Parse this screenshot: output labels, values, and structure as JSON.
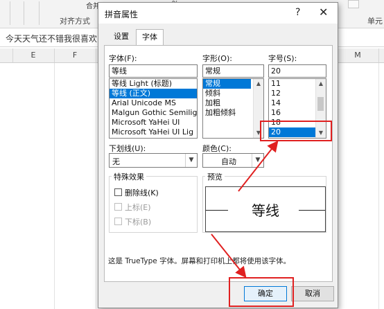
{
  "excel": {
    "ribbon_merge": "合并后居中",
    "ribbon_percent": "%",
    "ribbon_group_align": "对齐方式",
    "ribbon_right": "单元",
    "formula_text": "今天天气还不错我很喜欢",
    "columns": [
      "E",
      "F",
      "M"
    ]
  },
  "dialog": {
    "title": "拼音属性",
    "help": "?",
    "close": "✕",
    "tabs": [
      {
        "label": "设置",
        "active": false
      },
      {
        "label": "字体",
        "active": true
      }
    ],
    "font_label": "字体(F):",
    "font_value": "等线",
    "font_list": [
      "等线 Light (标题)",
      "等线 (正文)",
      "Arial Unicode MS",
      "Malgun Gothic Semilig",
      "Microsoft YaHei UI",
      "Microsoft YaHei UI Lig"
    ],
    "font_selected_index": 1,
    "style_label": "字形(O):",
    "style_value": "常规",
    "style_list": [
      "常规",
      "倾斜",
      "加粗",
      "加粗倾斜"
    ],
    "style_selected_index": 0,
    "size_label": "字号(S):",
    "size_value": "20",
    "size_list": [
      "11",
      "12",
      "14",
      "16",
      "18",
      "20"
    ],
    "size_selected_index": 5,
    "underline_label": "下划线(U):",
    "underline_value": "无",
    "color_label": "颜色(C):",
    "color_value": "自动",
    "effects_title": "特殊效果",
    "effects": [
      {
        "label": "删除线(K)",
        "enabled": true,
        "checked": false
      },
      {
        "label": "上标(E)",
        "enabled": false,
        "checked": false
      },
      {
        "label": "下标(B)",
        "enabled": false,
        "checked": false
      }
    ],
    "preview_title": "预览",
    "preview_text": "等线",
    "note": "这是 TrueType 字体。屏幕和打印机上都将使用该字体。",
    "ok": "确定",
    "cancel": "取消"
  },
  "colors": {
    "selection": "#0078d7",
    "annotation": "#e02020"
  }
}
